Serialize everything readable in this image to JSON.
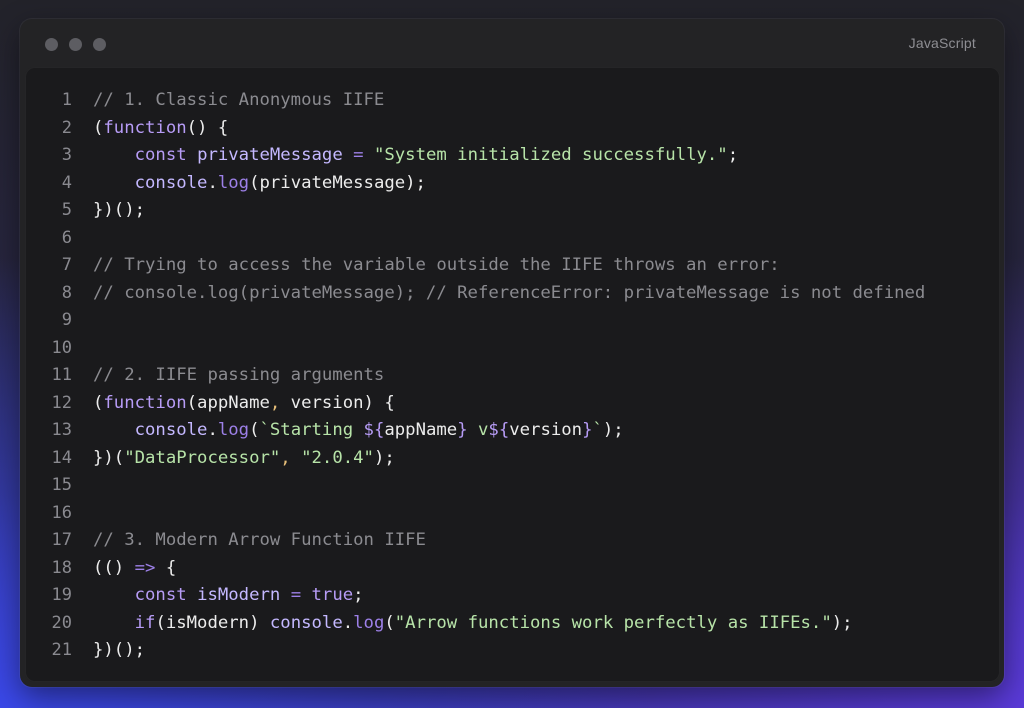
{
  "window": {
    "language": "JavaScript"
  },
  "colors": {
    "keyword": "#b79cf6",
    "function": "#9d80e8",
    "string": "#b7e3a8",
    "variable": "#c4b8ff",
    "comment": "#8b8b90",
    "plain": "#ececec"
  },
  "code": {
    "lines": [
      {
        "number": "1",
        "tokens": [
          {
            "t": "cmt",
            "v": "// 1. Classic Anonymous IIFE"
          }
        ]
      },
      {
        "number": "2",
        "tokens": [
          {
            "t": "pun",
            "v": "("
          },
          {
            "t": "kw",
            "v": "function"
          },
          {
            "t": "pun",
            "v": "() {"
          }
        ]
      },
      {
        "number": "3",
        "tokens": [
          {
            "t": "def",
            "v": "    "
          },
          {
            "t": "kw",
            "v": "const"
          },
          {
            "t": "def",
            "v": " "
          },
          {
            "t": "var",
            "v": "privateMessage"
          },
          {
            "t": "def",
            "v": " "
          },
          {
            "t": "op",
            "v": "="
          },
          {
            "t": "def",
            "v": " "
          },
          {
            "t": "str",
            "v": "\"System initialized successfully.\""
          },
          {
            "t": "pun",
            "v": ";"
          }
        ]
      },
      {
        "number": "4",
        "tokens": [
          {
            "t": "def",
            "v": "    "
          },
          {
            "t": "var",
            "v": "console"
          },
          {
            "t": "pun",
            "v": "."
          },
          {
            "t": "fn",
            "v": "log"
          },
          {
            "t": "pun",
            "v": "(privateMessage);"
          }
        ]
      },
      {
        "number": "5",
        "tokens": [
          {
            "t": "pun",
            "v": "})();"
          }
        ]
      },
      {
        "number": "6",
        "tokens": []
      },
      {
        "number": "7",
        "tokens": [
          {
            "t": "cmt",
            "v": "// Trying to access the variable outside the IIFE throws an error:"
          }
        ]
      },
      {
        "number": "8",
        "tokens": [
          {
            "t": "cmt",
            "v": "// console.log(privateMessage); // ReferenceError: privateMessage is not defined"
          }
        ]
      },
      {
        "number": "9",
        "tokens": []
      },
      {
        "number": "10",
        "tokens": []
      },
      {
        "number": "11",
        "tokens": [
          {
            "t": "cmt",
            "v": "// 2. IIFE passing arguments"
          }
        ]
      },
      {
        "number": "12",
        "tokens": [
          {
            "t": "pun",
            "v": "("
          },
          {
            "t": "kw",
            "v": "function"
          },
          {
            "t": "pun",
            "v": "(appName"
          },
          {
            "t": "com",
            "v": ","
          },
          {
            "t": "pun",
            "v": " version) {"
          }
        ]
      },
      {
        "number": "13",
        "tokens": [
          {
            "t": "def",
            "v": "    "
          },
          {
            "t": "var",
            "v": "console"
          },
          {
            "t": "pun",
            "v": "."
          },
          {
            "t": "fn",
            "v": "log"
          },
          {
            "t": "pun",
            "v": "("
          },
          {
            "t": "str",
            "v": "`Starting "
          },
          {
            "t": "kw",
            "v": "${"
          },
          {
            "t": "pun",
            "v": "appName"
          },
          {
            "t": "kw",
            "v": "}"
          },
          {
            "t": "str",
            "v": " v"
          },
          {
            "t": "kw",
            "v": "${"
          },
          {
            "t": "pun",
            "v": "version"
          },
          {
            "t": "kw",
            "v": "}"
          },
          {
            "t": "str",
            "v": "`"
          },
          {
            "t": "pun",
            "v": ");"
          }
        ]
      },
      {
        "number": "14",
        "tokens": [
          {
            "t": "pun",
            "v": "})("
          },
          {
            "t": "str",
            "v": "\"DataProcessor\""
          },
          {
            "t": "com",
            "v": ","
          },
          {
            "t": "def",
            "v": " "
          },
          {
            "t": "str",
            "v": "\"2.0.4\""
          },
          {
            "t": "pun",
            "v": ");"
          }
        ]
      },
      {
        "number": "15",
        "tokens": []
      },
      {
        "number": "16",
        "tokens": []
      },
      {
        "number": "17",
        "tokens": [
          {
            "t": "cmt",
            "v": "// 3. Modern Arrow Function IIFE"
          }
        ]
      },
      {
        "number": "18",
        "tokens": [
          {
            "t": "pun",
            "v": "(() "
          },
          {
            "t": "op",
            "v": "=>"
          },
          {
            "t": "pun",
            "v": " {"
          }
        ]
      },
      {
        "number": "19",
        "tokens": [
          {
            "t": "def",
            "v": "    "
          },
          {
            "t": "kw",
            "v": "const"
          },
          {
            "t": "def",
            "v": " "
          },
          {
            "t": "var",
            "v": "isModern"
          },
          {
            "t": "def",
            "v": " "
          },
          {
            "t": "op",
            "v": "="
          },
          {
            "t": "def",
            "v": " "
          },
          {
            "t": "kw",
            "v": "true"
          },
          {
            "t": "pun",
            "v": ";"
          }
        ]
      },
      {
        "number": "20",
        "tokens": [
          {
            "t": "def",
            "v": "    "
          },
          {
            "t": "kw",
            "v": "if"
          },
          {
            "t": "pun",
            "v": "(isModern) "
          },
          {
            "t": "var",
            "v": "console"
          },
          {
            "t": "pun",
            "v": "."
          },
          {
            "t": "fn",
            "v": "log"
          },
          {
            "t": "pun",
            "v": "("
          },
          {
            "t": "str",
            "v": "\"Arrow functions work perfectly as IIFEs.\""
          },
          {
            "t": "pun",
            "v": ");"
          }
        ]
      },
      {
        "number": "21",
        "tokens": [
          {
            "t": "pun",
            "v": "})();"
          }
        ]
      }
    ]
  }
}
